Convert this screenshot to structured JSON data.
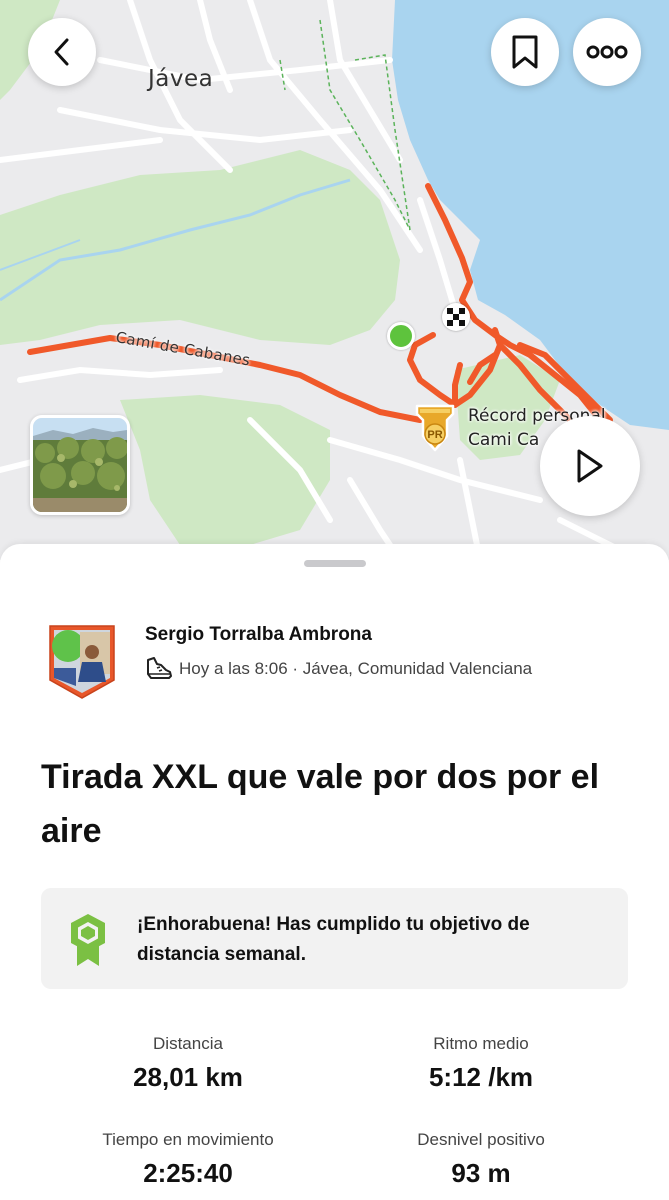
{
  "map": {
    "city_label": "Jávea",
    "road_label": "Camí de Cabanes",
    "pr_label_line1": "Récord personal",
    "pr_label_line2": "Cami Ca",
    "pr_badge_text": "PR",
    "colors": {
      "route": "#f0592a",
      "sea": "#a9d4ef",
      "park": "#cfe8c4",
      "land": "#ebebed",
      "start": "#5ec33d"
    }
  },
  "buttons": {
    "back_icon": "chevron-left-icon",
    "bookmark_icon": "bookmark-icon",
    "more_icon": "more-horizontal-icon",
    "play_icon": "play-icon"
  },
  "activity": {
    "athlete_name": "Sergio Torralba Ambrona",
    "sport_icon": "running-shoe-icon",
    "meta": "Hoy a las 8:06 · Jávea, Comunidad Valenciana",
    "title": "Tirada XXL que vale por dos por el aire"
  },
  "goal": {
    "icon": "goal-badge-icon",
    "text": "¡Enhorabuena! Has cumplido tu objetivo de distancia semanal.",
    "accent": "#7bc043"
  },
  "stats": {
    "distance": {
      "label": "Distancia",
      "value": "28,01 km"
    },
    "pace": {
      "label": "Ritmo medio",
      "value": "5:12 /km"
    },
    "moving_time": {
      "label": "Tiempo en movimiento",
      "value": "2:25:40"
    },
    "elevation": {
      "label": "Desnivel positivo",
      "value": "93 m"
    }
  }
}
